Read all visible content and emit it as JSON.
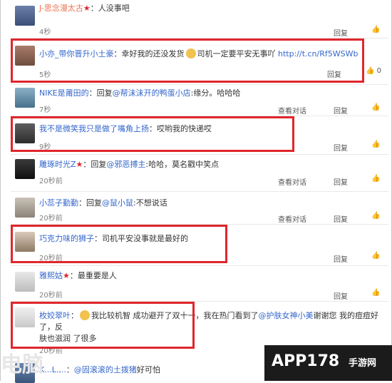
{
  "comments": [
    {
      "name": "J-思念漫太古",
      "star": true,
      "sep": "：",
      "text": "人没事吧",
      "time": "4秒",
      "reply": "回复",
      "count": ""
    },
    {
      "name": "小亦_带你晋升小土豪",
      "star": false,
      "sep": "：",
      "text_pre": "幸好我的还没发货",
      "text_post": "司机一定要平安无事吖",
      "link": "http://t.cn/Rf5WSWb",
      "time": "5秒",
      "reply": "回复",
      "count": "0"
    },
    {
      "name": "NIKE是莆田的",
      "star": false,
      "sep": "：",
      "text_pre": "回复",
      "mention": "@帮沫沫开的鸭蛋小店",
      "text_post": ":缘分。哈哈哈",
      "time": "7秒",
      "view": "查看对话",
      "reply": "回复",
      "count": ""
    },
    {
      "name": "我不是微笑我只是做了嘴角上扬",
      "star": false,
      "sep": "：",
      "text": "哎哟我的快递哎",
      "time": "9秒",
      "reply": "回复",
      "count": ""
    },
    {
      "name": "雕琢时光Z",
      "star": true,
      "sep": "：",
      "text_pre": "回复",
      "mention": "@邪恶搏主",
      "text_post": ":哈哈，莫名戳中笑点",
      "time": "20秒前",
      "view": "查看对话",
      "reply": "回复",
      "count": ""
    },
    {
      "name": "小蕊子勤勤",
      "star": false,
      "sep": "：",
      "text_pre": "回复",
      "mention": "@鼠小鼠",
      "text_post": ":不想说话",
      "time": "20秒前",
      "view": "查看对话",
      "reply": "回复",
      "count": ""
    },
    {
      "name": "巧克力味的狮子",
      "star": false,
      "sep": "：",
      "text": "司机平安没事就是最好的",
      "time": "20秒前",
      "reply": "回复",
      "count": ""
    },
    {
      "name": "雅熙姑",
      "star": true,
      "sep": "：",
      "text": "最重要是人",
      "time": "20秒前",
      "reply": "回复",
      "count": ""
    },
    {
      "name": "枚姣翠叶",
      "star": false,
      "sep": "：",
      "text_pre": "我比较机智 成功避开了双十一，我在热门看到了",
      "mention": "@护肤女神小美",
      "text_post": "谢谢您 我的痘痘好了，反",
      "text_line2": "肤也滋润 了很多",
      "time": "20秒前",
      "reply": "回复",
      "count": ""
    },
    {
      "name": "K...L.,..",
      "star": false,
      "sep": "：",
      "mention": "@固滚滚的土拨猪",
      "text_post": "好可怕",
      "time": "",
      "reply": "",
      "count": ""
    }
  ],
  "watermark": {
    "left_text": "电脑",
    "right_text": "APP178",
    "right_sub": "手游网"
  },
  "colors": {
    "name": "#eb7350",
    "link": "#3366cc",
    "highlight": "#e0262c"
  }
}
